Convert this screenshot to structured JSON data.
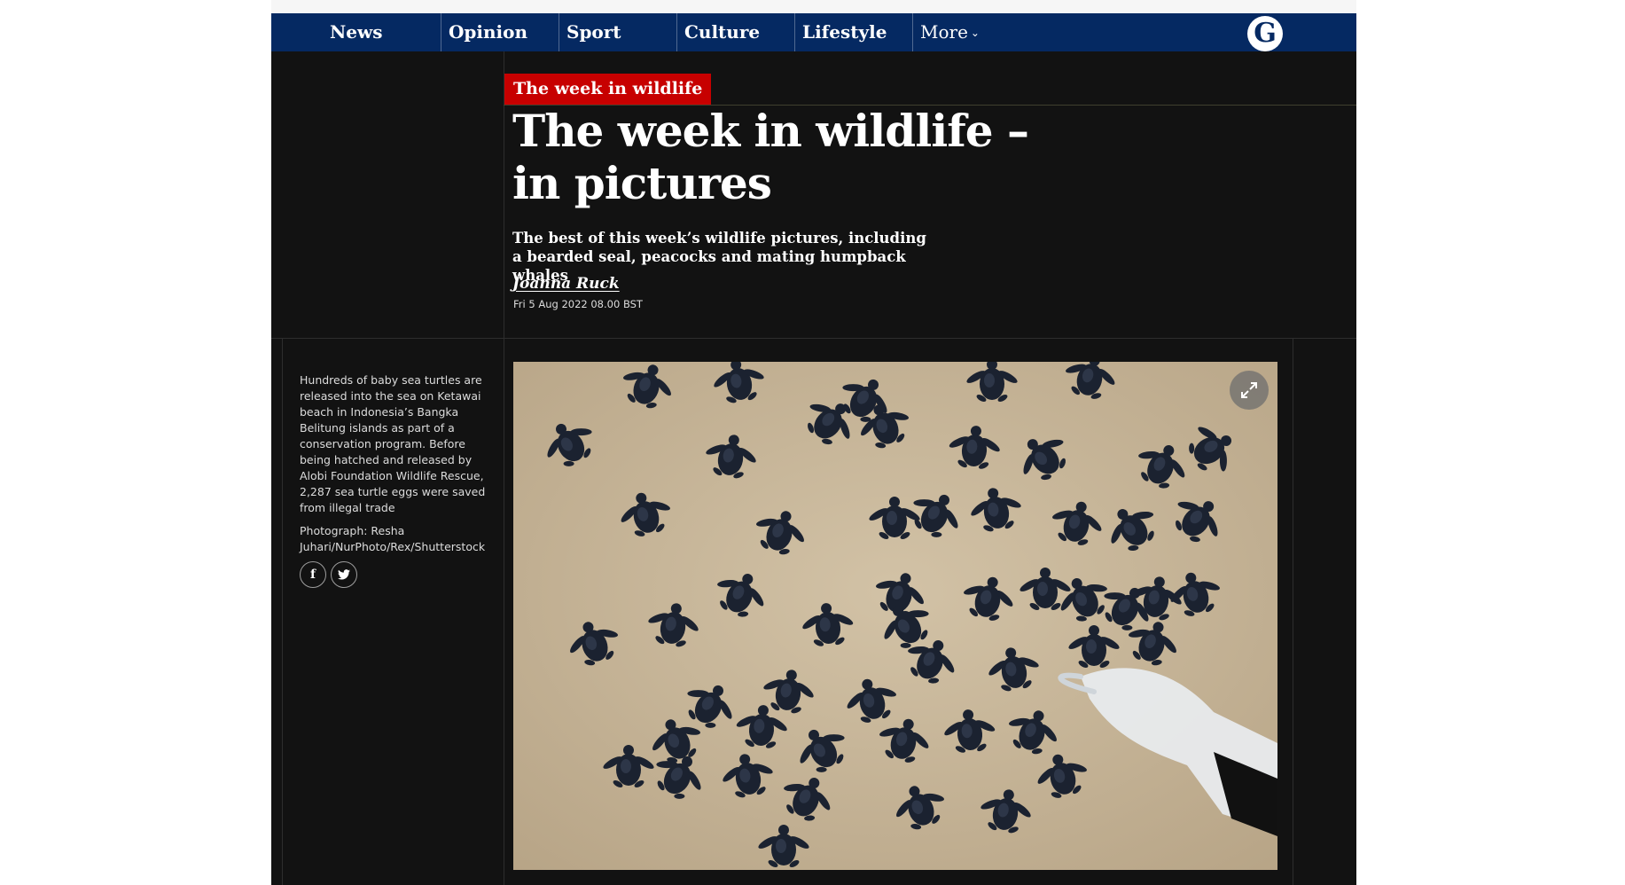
{
  "nav": {
    "items": [
      "News",
      "Opinion",
      "Sport",
      "Culture",
      "Lifestyle"
    ],
    "more_label": "More",
    "logo_letter": "G"
  },
  "article": {
    "kicker": "The week in wildlife",
    "headline": "The week in wildlife – in pictures",
    "standfirst": "The best of this week’s wildlife pictures, including a bearded seal, peacocks and mating humpback whales",
    "byline": "Joanna Ruck",
    "date": "Fri 5 Aug 2022 08.00 BST"
  },
  "gallery": {
    "caption": "Hundreds of baby sea turtles are released into the sea on Ketawai beach in Indonesia’s Bangka Belitung islands as part of a conservation program. Before being hatched and released by Alobi Foundation Wildlife Rescue, 2,287 sea turtle eggs were saved from illegal trade",
    "credit": "Photograph: Resha Juhari/NurPhoto/Rex/Shutterstock",
    "share": [
      "facebook-icon",
      "twitter-icon"
    ],
    "expand_icon": "expand-icon"
  },
  "colors": {
    "nav_bg": "#052962",
    "page_bg": "#121212",
    "kicker_bg": "#c70000",
    "sand": "#c9b79a",
    "turtle": "#1b2230"
  }
}
